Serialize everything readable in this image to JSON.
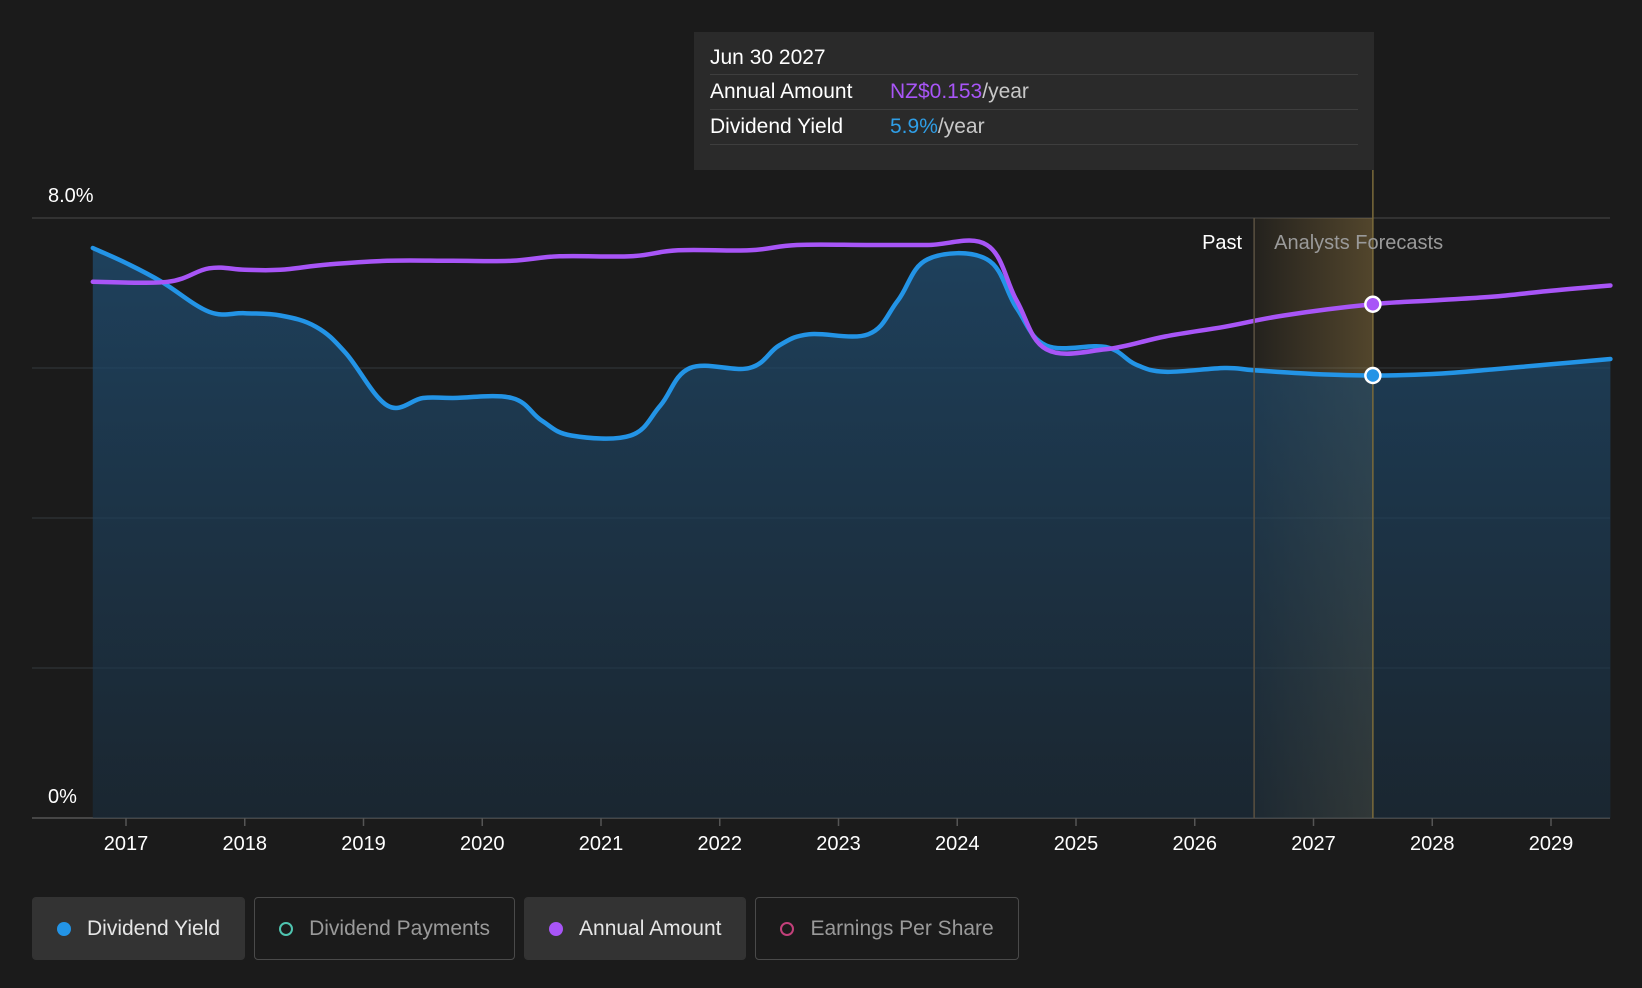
{
  "tooltip": {
    "date": "Jun 30 2027",
    "rows": [
      {
        "label": "Annual Amount",
        "value": "NZ$0.153",
        "unit": "/year",
        "color": "#a855f7"
      },
      {
        "label": "Dividend Yield",
        "value": "5.9%",
        "unit": "/year",
        "color": "#2f9ee6"
      }
    ]
  },
  "regions": {
    "past": "Past",
    "forecast": "Analysts Forecasts"
  },
  "legend": [
    {
      "label": "Dividend Yield",
      "color": "#2394e6",
      "active": true
    },
    {
      "label": "Dividend Payments",
      "color": "#4fc4b0",
      "active": false
    },
    {
      "label": "Annual Amount",
      "color": "#a855f7",
      "active": true
    },
    {
      "label": "Earnings Per Share",
      "color": "#c2407a",
      "active": false
    }
  ],
  "chart_data": {
    "type": "line",
    "y_axis": {
      "range": [
        0,
        8.0
      ],
      "tick_labels": [
        "0%",
        "8.0%"
      ],
      "unit": "%"
    },
    "x_axis": {
      "range": [
        2016.7,
        2029.5
      ],
      "tick_labels": [
        "2017",
        "2018",
        "2019",
        "2020",
        "2021",
        "2022",
        "2023",
        "2024",
        "2025",
        "2026",
        "2027",
        "2028",
        "2029"
      ]
    },
    "grid": true,
    "past_forecast_divider": 2026.5,
    "highlight_x": 2027.5,
    "series": [
      {
        "name": "Dividend Yield",
        "color": "#2394e6",
        "area": true,
        "points": [
          [
            2016.72,
            7.6
          ],
          [
            2017.0,
            7.4
          ],
          [
            2017.3,
            7.15
          ],
          [
            2017.7,
            6.75
          ],
          [
            2018.0,
            6.73
          ],
          [
            2018.3,
            6.7
          ],
          [
            2018.6,
            6.55
          ],
          [
            2018.85,
            6.2
          ],
          [
            2019.2,
            5.5
          ],
          [
            2019.5,
            5.6
          ],
          [
            2019.75,
            5.6
          ],
          [
            2020.25,
            5.6
          ],
          [
            2020.5,
            5.3
          ],
          [
            2020.75,
            5.1
          ],
          [
            2021.25,
            5.1
          ],
          [
            2021.5,
            5.5
          ],
          [
            2021.75,
            6.0
          ],
          [
            2022.25,
            6.0
          ],
          [
            2022.5,
            6.3
          ],
          [
            2022.75,
            6.45
          ],
          [
            2023.25,
            6.45
          ],
          [
            2023.5,
            6.9
          ],
          [
            2023.75,
            7.45
          ],
          [
            2024.25,
            7.45
          ],
          [
            2024.5,
            6.8
          ],
          [
            2024.75,
            6.3
          ],
          [
            2025.25,
            6.28
          ],
          [
            2025.5,
            6.05
          ],
          [
            2025.75,
            5.95
          ],
          [
            2026.25,
            6.0
          ],
          [
            2026.5,
            5.97
          ],
          [
            2027.0,
            5.92
          ],
          [
            2027.5,
            5.9
          ],
          [
            2028.0,
            5.92
          ],
          [
            2028.5,
            5.98
          ],
          [
            2029.0,
            6.05
          ],
          [
            2029.5,
            6.12
          ]
        ]
      },
      {
        "name": "Annual Amount",
        "color": "#a855f7",
        "area": false,
        "points": [
          [
            2016.72,
            7.15
          ],
          [
            2017.35,
            7.15
          ],
          [
            2017.7,
            7.33
          ],
          [
            2018.0,
            7.31
          ],
          [
            2018.3,
            7.31
          ],
          [
            2018.7,
            7.38
          ],
          [
            2019.2,
            7.43
          ],
          [
            2019.75,
            7.43
          ],
          [
            2020.25,
            7.43
          ],
          [
            2020.65,
            7.49
          ],
          [
            2021.25,
            7.49
          ],
          [
            2021.65,
            7.57
          ],
          [
            2022.25,
            7.57
          ],
          [
            2022.65,
            7.64
          ],
          [
            2023.25,
            7.64
          ],
          [
            2023.75,
            7.64
          ],
          [
            2024.25,
            7.64
          ],
          [
            2024.5,
            6.9
          ],
          [
            2024.75,
            6.25
          ],
          [
            2025.25,
            6.25
          ],
          [
            2025.75,
            6.42
          ],
          [
            2026.25,
            6.55
          ],
          [
            2026.75,
            6.7
          ],
          [
            2027.5,
            6.85
          ],
          [
            2028.0,
            6.9
          ],
          [
            2028.5,
            6.95
          ],
          [
            2029.0,
            7.03
          ],
          [
            2029.5,
            7.1
          ]
        ]
      }
    ]
  }
}
